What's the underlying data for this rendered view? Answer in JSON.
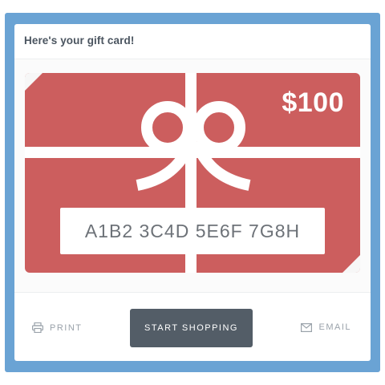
{
  "header": {
    "title": "Here's your gift card!"
  },
  "gift_card": {
    "amount": "$100",
    "code": "A1B2 3C4D 5E6F 7G8H",
    "card_color": "#cc5e5e",
    "ribbon_color": "#ffffff"
  },
  "actions": {
    "print_label": "PRINT",
    "print_icon": "printer-icon",
    "start_shopping_label": "START SHOPPING",
    "email_label": "EMAIL",
    "email_icon": "envelope-icon"
  },
  "colors": {
    "frame": "#6aa3d4",
    "button": "#535d67",
    "muted_text": "#9aa2aa"
  }
}
